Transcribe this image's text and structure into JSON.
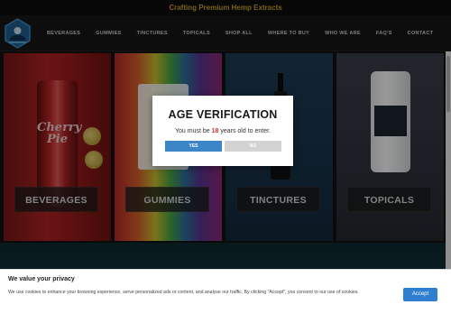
{
  "topbar": {
    "text": "Crafting Premium Hemp Extracts"
  },
  "nav": {
    "items": [
      {
        "label": "BEVERAGES"
      },
      {
        "label": "GUMMIES"
      },
      {
        "label": "TINCTURES"
      },
      {
        "label": "TOPICALS"
      },
      {
        "label": "SHOP ALL"
      },
      {
        "label": "WHERE TO BUY"
      },
      {
        "label": "WHO WE ARE"
      },
      {
        "label": "FAQ'S"
      },
      {
        "label": "CONTACT"
      }
    ]
  },
  "tiles": [
    {
      "label": "BEVERAGES",
      "can_text": "Cherry Pie"
    },
    {
      "label": "GUMMIES"
    },
    {
      "label": "TINCTURES"
    },
    {
      "label": "TOPICALS"
    }
  ],
  "age_modal": {
    "title": "AGE VERIFICATION",
    "message_before": "You must be ",
    "age": "18",
    "message_after": " years old to enter.",
    "yes_label": "YES",
    "no_label": "NO"
  },
  "cookie": {
    "title": "We value your privacy",
    "text": "We use cookies to enhance your browsing experience, serve personalized ads or content, and analyse our traffic. By clicking \"Accept\", you consent to our use of cookies.",
    "accept_label": "Accept"
  },
  "colors": {
    "accent": "#c9a227",
    "yes_button": "#3c86c8",
    "no_button": "#d3d3d3",
    "accept_button": "#2f7fd0",
    "age_highlight": "#d32f2f"
  }
}
